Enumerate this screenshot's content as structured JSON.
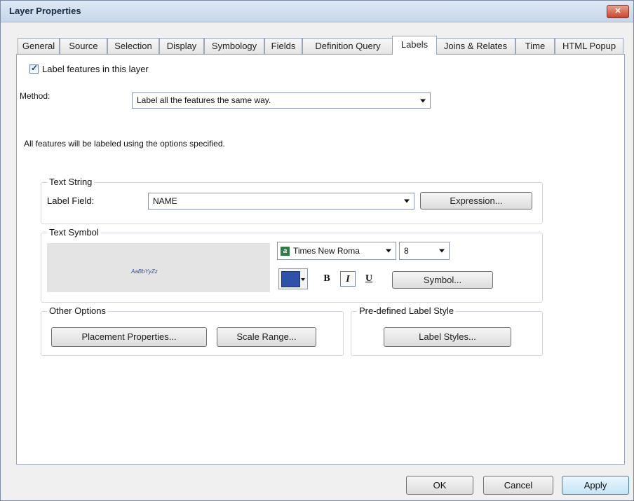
{
  "window": {
    "title": "Layer Properties",
    "close_icon": "close-icon"
  },
  "tabs": [
    "General",
    "Source",
    "Selection",
    "Display",
    "Symbology",
    "Fields",
    "Definition Query",
    "Labels",
    "Joins & Relates",
    "Time",
    "HTML Popup"
  ],
  "active_tab": "Labels",
  "labels_tab": {
    "label_checkbox": {
      "label": "Label features in this layer",
      "checked": true
    },
    "method_label": "Method:",
    "method_value": "Label all the features the same way.",
    "info_text": "All features will be labeled using the options specified."
  },
  "text_string": {
    "group_title": "Text String",
    "field_label": "Label Field:",
    "field_value": "NAME",
    "expression_button": "Expression..."
  },
  "text_symbol": {
    "group_title": "Text Symbol",
    "preview_text": "AaBbYyZz",
    "font_name": "Times New Roma",
    "font_size": "8",
    "color": "#2d52a7",
    "bold": "B",
    "italic": "I",
    "underline": "U",
    "symbol_button": "Symbol..."
  },
  "other_options": {
    "group_title": "Other Options",
    "placement_button": "Placement Properties...",
    "scale_button": "Scale Range..."
  },
  "predefined": {
    "group_title": "Pre-defined Label Style",
    "styles_button": "Label Styles..."
  },
  "footer": {
    "ok": "OK",
    "cancel": "Cancel",
    "apply": "Apply"
  }
}
